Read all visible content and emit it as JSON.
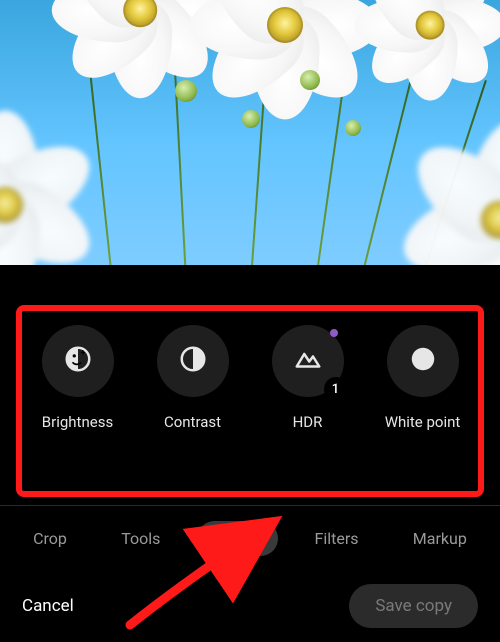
{
  "adjust": {
    "items": [
      {
        "label": "Brightness"
      },
      {
        "label": "Contrast"
      },
      {
        "label": "HDR",
        "badge": "1"
      },
      {
        "label": "White point"
      }
    ]
  },
  "tabs": {
    "items": [
      {
        "label": "Crop"
      },
      {
        "label": "Tools"
      },
      {
        "label": "Adjust"
      },
      {
        "label": "Filters"
      },
      {
        "label": "Markup"
      }
    ],
    "active_index": 2
  },
  "footer": {
    "cancel": "Cancel",
    "save": "Save copy"
  }
}
